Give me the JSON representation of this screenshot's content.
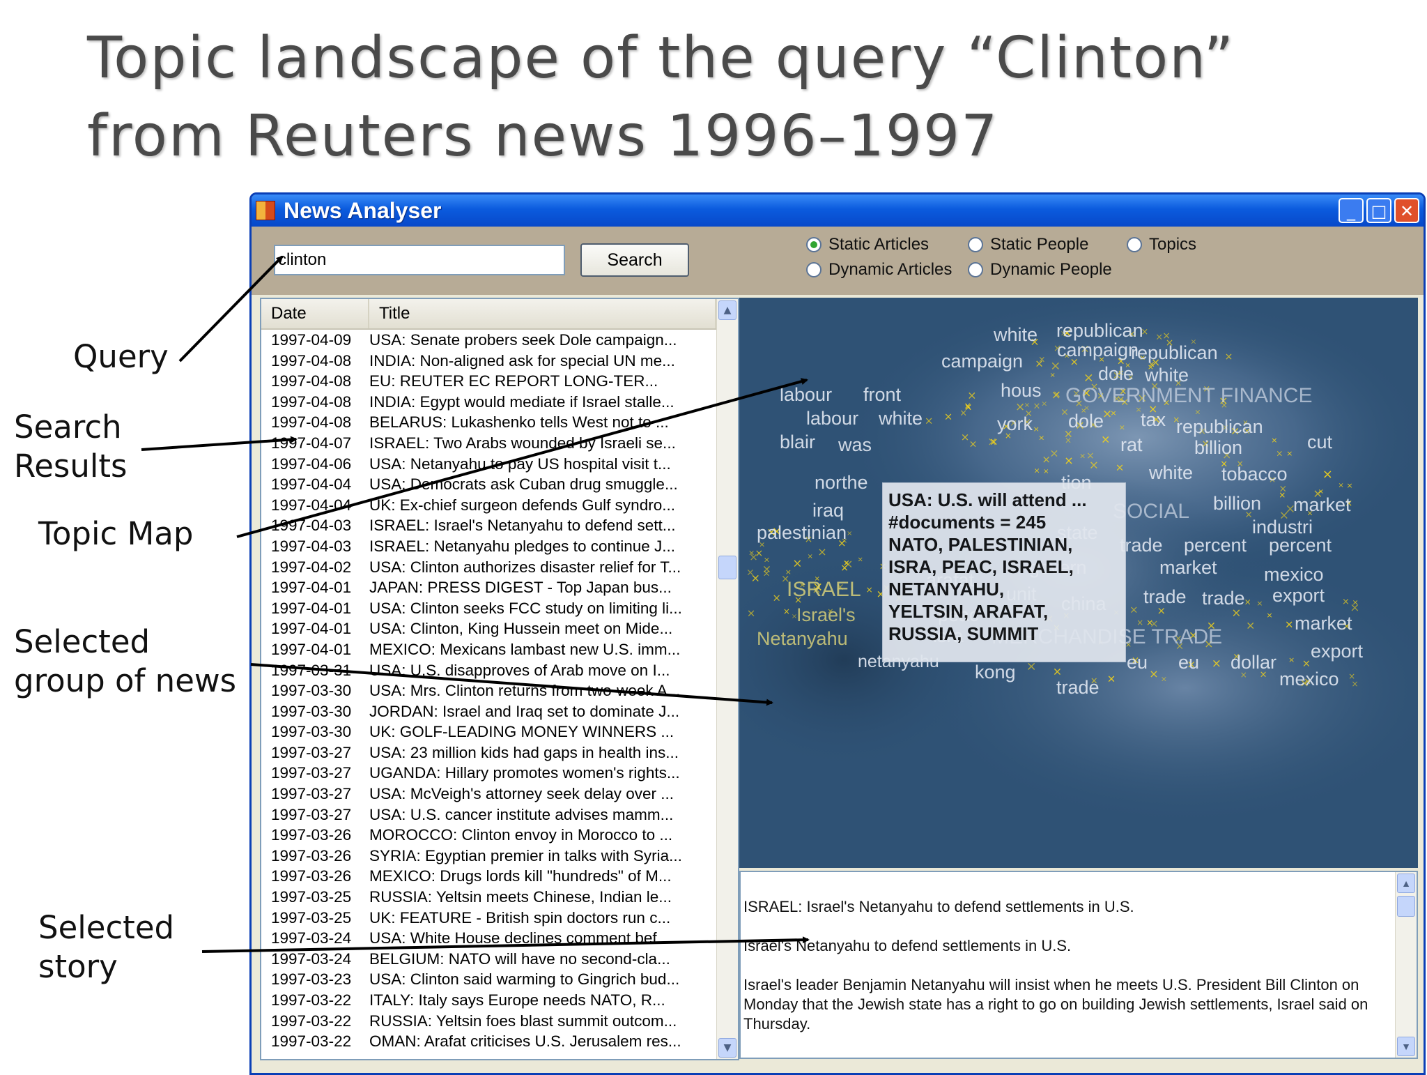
{
  "slide": {
    "title_line1": "Topic landscape of the query “Clinton”",
    "title_line2": "from Reuters news 1996–1997"
  },
  "callouts": {
    "query": "Query",
    "search_results_1": "Search",
    "search_results_2": "Results",
    "topic_map": "Topic Map",
    "selected_group_1": "Selected",
    "selected_group_2": "group of news",
    "selected_story_1": "Selected",
    "selected_story_2": "story"
  },
  "window": {
    "title": "News Analyser",
    "buttons": {
      "minimize": "_",
      "maximize": "□",
      "close": "✕"
    }
  },
  "toolbar": {
    "query_value": "clinton",
    "search_label": "Search",
    "radios": {
      "static_articles": "Static Articles",
      "dynamic_articles": "Dynamic Articles",
      "static_people": "Static People",
      "dynamic_people": "Dynamic People",
      "topics": "Topics"
    },
    "selected_radio": "static_articles"
  },
  "results": {
    "columns": {
      "date": "Date",
      "title": "Title"
    },
    "rows": [
      [
        "1997-04-09",
        "USA: Senate probers seek Dole campaign..."
      ],
      [
        "1997-04-08",
        "INDIA: Non-aligned ask for special UN me..."
      ],
      [
        "1997-04-08",
        "EU:  REUTER EC REPORT LONG-TER..."
      ],
      [
        "1997-04-08",
        "INDIA: Egypt would mediate if Israel stalle..."
      ],
      [
        "1997-04-08",
        "BELARUS: Lukashenko tells West not to ..."
      ],
      [
        "1997-04-07",
        "ISRAEL: Two Arabs wounded by Israeli se..."
      ],
      [
        "1997-04-06",
        "USA: Netanyahu to pay US hospital visit t..."
      ],
      [
        "1997-04-04",
        "USA: Democrats ask Cuban drug smuggle..."
      ],
      [
        "1997-04-04",
        "UK: Ex-chief surgeon defends Gulf syndro..."
      ],
      [
        "1997-04-03",
        "ISRAEL: Israel's Netanyahu to defend sett..."
      ],
      [
        "1997-04-03",
        "ISRAEL: Netanyahu pledges to continue J..."
      ],
      [
        "1997-04-02",
        "USA: Clinton authorizes disaster relief for T..."
      ],
      [
        "1997-04-01",
        "JAPAN: PRESS DIGEST - Top Japan bus..."
      ],
      [
        "1997-04-01",
        "USA: Clinton seeks FCC study on limiting li..."
      ],
      [
        "1997-04-01",
        "USA: Clinton, King Hussein meet on Mide..."
      ],
      [
        "1997-04-01",
        "MEXICO: Mexicans lambast new U.S. imm..."
      ],
      [
        "1997-03-31",
        "USA: U.S. disapproves of Arab move on I..."
      ],
      [
        "1997-03-30",
        "USA: Mrs. Clinton returns from two-week A..."
      ],
      [
        "1997-03-30",
        "JORDAN: Israel and Iraq set to dominate J..."
      ],
      [
        "1997-03-30",
        "UK: GOLF-LEADING MONEY WINNERS ..."
      ],
      [
        "1997-03-27",
        "USA: 23 million kids had gaps in health ins..."
      ],
      [
        "1997-03-27",
        "UGANDA: Hillary promotes women's rights..."
      ],
      [
        "1997-03-27",
        "USA: McVeigh's attorney seek delay over ..."
      ],
      [
        "1997-03-27",
        "USA: U.S. cancer institute advises mamm..."
      ],
      [
        "1997-03-26",
        "MOROCCO: Clinton envoy in Morocco to ..."
      ],
      [
        "1997-03-26",
        "SYRIA: Egyptian premier in talks with Syria..."
      ],
      [
        "1997-03-26",
        "MEXICO: Drugs lords kill \"hundreds\" of M..."
      ],
      [
        "1997-03-25",
        "RUSSIA: Yeltsin meets Chinese, Indian le..."
      ],
      [
        "1997-03-25",
        "UK: FEATURE - British spin doctors run c..."
      ],
      [
        "1997-03-24",
        "USA: White House declines comment bef..."
      ],
      [
        "1997-03-24",
        "BELGIUM: NATO will have no second-cla..."
      ],
      [
        "1997-03-23",
        "USA: Clinton said warming to Gingrich bud..."
      ],
      [
        "1997-03-22",
        "ITALY: Italy says Europe needs NATO, R..."
      ],
      [
        "1997-03-22",
        "RUSSIA: Yeltsin foes blast summit outcom..."
      ],
      [
        "1997-03-22",
        "OMAN: Arafat criticises U.S. Jerusalem res..."
      ]
    ]
  },
  "topic_map": {
    "words": [
      "white",
      "republican",
      "campaign",
      "campaign",
      "republican",
      "dole",
      "white",
      "labour",
      "front",
      "hous",
      "GOVERNMENT FINANCE",
      "labour",
      "white",
      "york",
      "dole",
      "tax",
      "republican",
      "blair",
      "was",
      "rat",
      "billion",
      "cut",
      "white",
      "tobacco",
      "northe",
      "tion",
      "billion",
      "market",
      "iraq",
      "SOCIAL",
      "industri",
      "palestinian",
      "state",
      "trade",
      "percent",
      "percent",
      "govern",
      "market",
      "mexico",
      "ISRAEL",
      "arafat",
      "unit",
      "china",
      "trade",
      "trade",
      "export",
      "Israel's",
      "peac",
      "market",
      "Netanyahu",
      "isra",
      "MERCHANDISE TRADE",
      "export",
      "netanyahu",
      "kong",
      "eu",
      "eu",
      "dollar",
      "mexico",
      "trade"
    ],
    "tooltip": {
      "title": "USA: U.S. will attend ...",
      "count": "#documents = 245",
      "terms_1": "NATO, PALESTINIAN,",
      "terms_2": "ISRA, PEAC, ISRAEL,",
      "terms_3": "NETANYAHU,",
      "terms_4": "YELTSIN, ARAFAT,",
      "terms_5": "RUSSIA, SUMMIT"
    }
  },
  "story": {
    "headline": "ISRAEL: Israel's Netanyahu to defend settlements in U.S.",
    "subhead": "Israel's Netanyahu to defend settlements in U.S.",
    "body": "Israel's leader Benjamin Netanyahu will insist when he meets U.S. President Bill Clinton on Monday that the Jewish state has a right to go on building Jewish settlements, Israel said on Thursday."
  },
  "colors": {
    "map_background": "#2f5275",
    "marker": "#f2d21a",
    "titlebar": "#0b5bde",
    "radio_on": "#31a531"
  },
  "icons": [
    "app-icon",
    "minimize-icon",
    "maximize-icon",
    "close-icon",
    "scroll-up-icon",
    "scroll-down-icon",
    "radio-icon",
    "star-marker-icon"
  ]
}
